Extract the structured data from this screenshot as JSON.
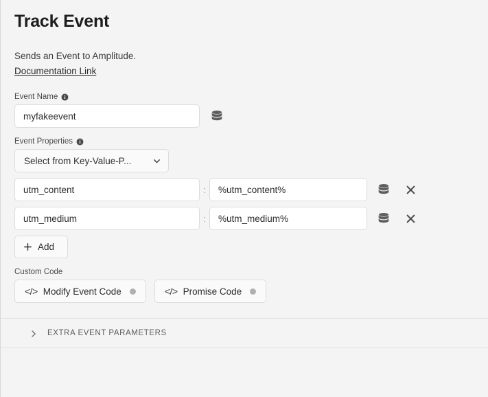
{
  "header": {
    "title": "Track Event",
    "description": "Sends an Event to Amplitude.",
    "doc_link": "Documentation Link"
  },
  "event_name": {
    "label": "Event Name",
    "value": "myfakeevent",
    "info_icon": "info-icon",
    "db_icon": "database-icon"
  },
  "event_properties": {
    "label": "Event Properties",
    "info_icon": "info-icon",
    "select": {
      "value": "Select from Key-Value-P...",
      "chevron_icon": "chevron-down-icon"
    },
    "separator": ":",
    "rows": [
      {
        "key": "utm_content",
        "value": "%utm_content%",
        "db_icon": "database-icon",
        "remove_icon": "close-icon"
      },
      {
        "key": "utm_medium",
        "value": "%utm_medium%",
        "db_icon": "database-icon",
        "remove_icon": "close-icon"
      }
    ],
    "add_button": {
      "label": "Add",
      "icon": "plus-icon"
    }
  },
  "custom_code": {
    "label": "Custom Code",
    "buttons": [
      {
        "label": "Modify Event Code",
        "icon": "code-icon",
        "status_dot_color": "#b0b0b0"
      },
      {
        "label": "Promise Code",
        "icon": "code-icon",
        "status_dot_color": "#b0b0b0"
      }
    ]
  },
  "extra_parameters": {
    "label": "EXTRA EVENT PARAMETERS",
    "chevron_icon": "chevron-right-icon",
    "expanded": false
  },
  "colors": {
    "background": "#f4f4f4",
    "input_background": "#ffffff",
    "border": "#dcdcdc",
    "text": "#2c2c2c",
    "muted_text": "#5c5c5c"
  }
}
